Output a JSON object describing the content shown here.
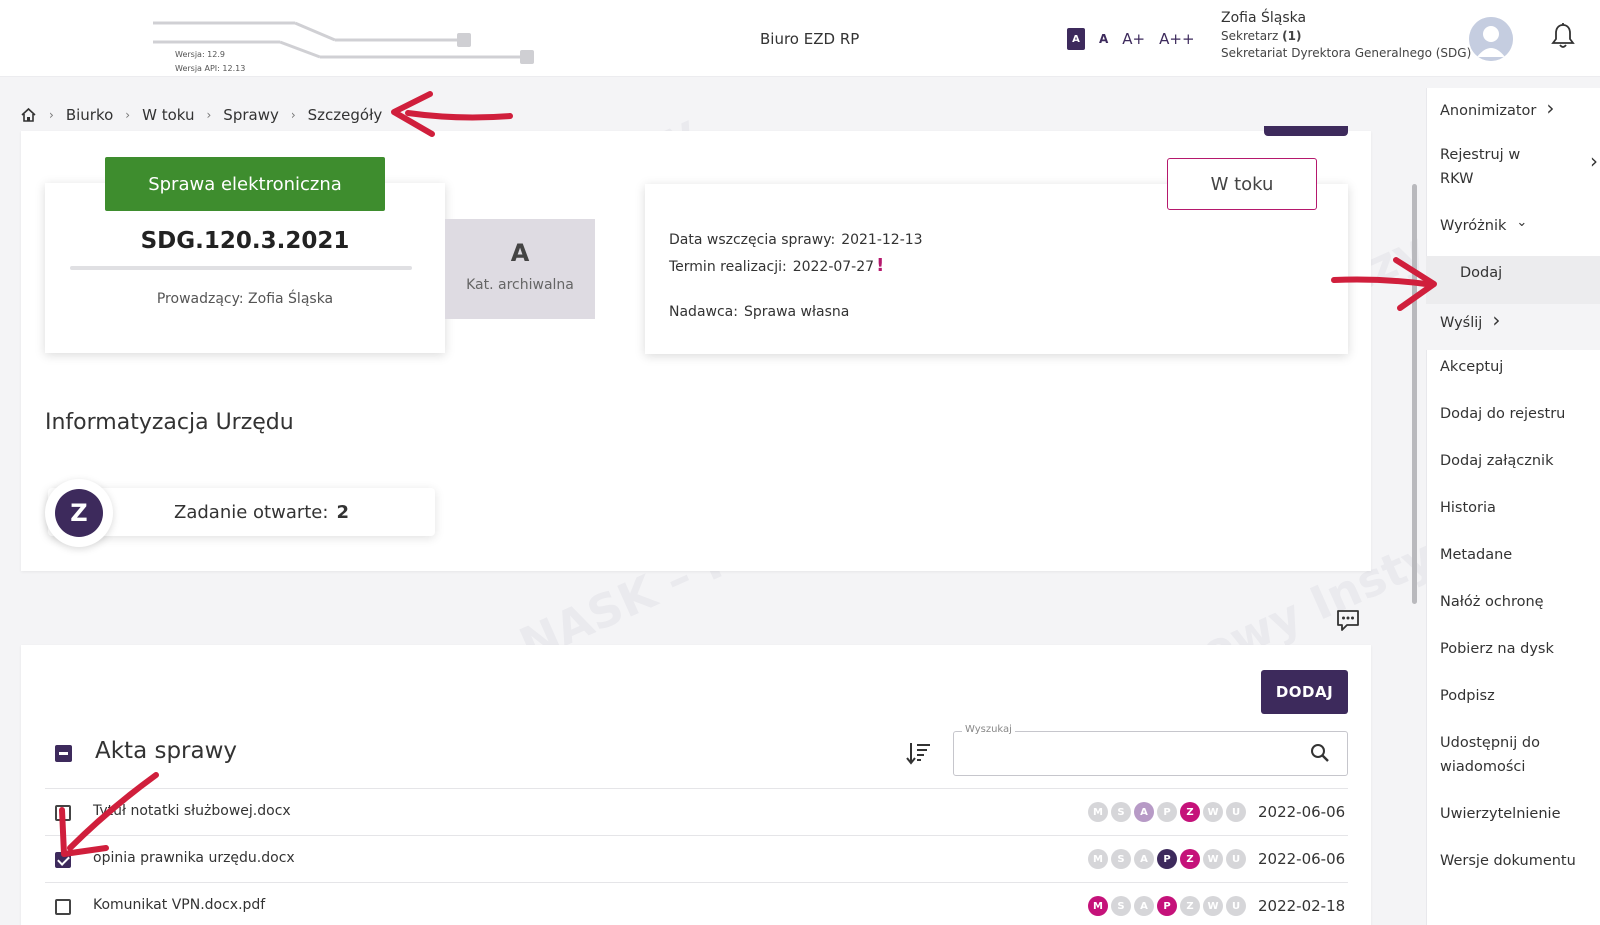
{
  "header": {
    "version": "Wersja: 12.9",
    "api_version": "Wersja API: 12.13",
    "app_title": "Biuro EZD RP",
    "font_sizes": [
      "A",
      "A",
      "A+",
      "A++"
    ],
    "user": {
      "name": "Zofia Śląska",
      "role": "Sekretarz",
      "role_count": "(1)",
      "department": "Sekretariat Dyrektora Generalnego (SDG)"
    }
  },
  "breadcrumb": [
    "Biurko",
    "W toku",
    "Sprawy",
    "Szczegóły"
  ],
  "case": {
    "type_label": "Sprawa elektroniczna",
    "number": "SDG.120.3.2021",
    "owner": "Prowadzący: Zofia Śląska",
    "archive_category": "A",
    "archive_label": "Kat. archiwalna",
    "status": "W toku",
    "start_label": "Data wszczęcia sprawy:",
    "start_date": "2021-12-13",
    "deadline_label": "Termin realizacji:",
    "deadline_date": "2022-07-27",
    "sender_label": "Nadawca:",
    "sender": "Sprawa własna",
    "subject": "Informatyzacja Urzędu",
    "task_initial": "Z",
    "task_label": "Zadanie otwarte:",
    "task_count": "2"
  },
  "documents": {
    "title": "Akta sprawy",
    "add_label": "DODAJ",
    "search_label": "Wyszukaj",
    "rows": [
      {
        "name": "Tytuł notatki służbowej.docx",
        "checked": false,
        "date": "2022-06-06",
        "badges": [
          [
            "M",
            "off"
          ],
          [
            "S",
            "off"
          ],
          [
            "A",
            "light"
          ],
          [
            "P",
            "off"
          ],
          [
            "Z",
            "pink"
          ],
          [
            "W",
            "off"
          ],
          [
            "U",
            "off"
          ]
        ]
      },
      {
        "name": "opinia prawnika urzędu.docx",
        "checked": true,
        "date": "2022-06-06",
        "badges": [
          [
            "M",
            "off"
          ],
          [
            "S",
            "off"
          ],
          [
            "A",
            "off"
          ],
          [
            "P",
            "dark"
          ],
          [
            "Z",
            "pink"
          ],
          [
            "W",
            "off"
          ],
          [
            "U",
            "off"
          ]
        ]
      },
      {
        "name": "Komunikat VPN.docx.pdf",
        "checked": false,
        "date": "2022-02-18",
        "badges": [
          [
            "M",
            "pink"
          ],
          [
            "S",
            "off"
          ],
          [
            "A",
            "off"
          ],
          [
            "P",
            "pink"
          ],
          [
            "Z",
            "off"
          ],
          [
            "W",
            "off"
          ],
          [
            "U",
            "off"
          ]
        ]
      }
    ]
  },
  "menu": {
    "items": [
      {
        "label": "Anonimizator",
        "chevron": "right"
      },
      {
        "label": "Rejestruj w",
        "label2": "RKW",
        "chevron": "right"
      },
      {
        "label": "Wyróżnik",
        "chevron": "down"
      },
      {
        "label": "Dodaj",
        "sub": true
      },
      {
        "label": "Wyślij",
        "chevron": "right"
      },
      {
        "label": "Akceptuj"
      },
      {
        "label": "Dodaj do rejestru"
      },
      {
        "label": "Dodaj załącznik"
      },
      {
        "label": "Historia"
      },
      {
        "label": "Metadane"
      },
      {
        "label": "Nałóż ochronę"
      },
      {
        "label": "Pobierz na dysk"
      },
      {
        "label": "Podpisz"
      },
      {
        "label": "Udostępnij do",
        "label2": "wiadomości"
      },
      {
        "label": "Uwierzytelnienie"
      },
      {
        "label": "Wersje dokumentu"
      }
    ]
  },
  "colors": {
    "primary": "#3d2a5c",
    "accent_pink": "#c5127a",
    "green": "#3e8d2e",
    "annotation_red": "#d01f3c"
  }
}
